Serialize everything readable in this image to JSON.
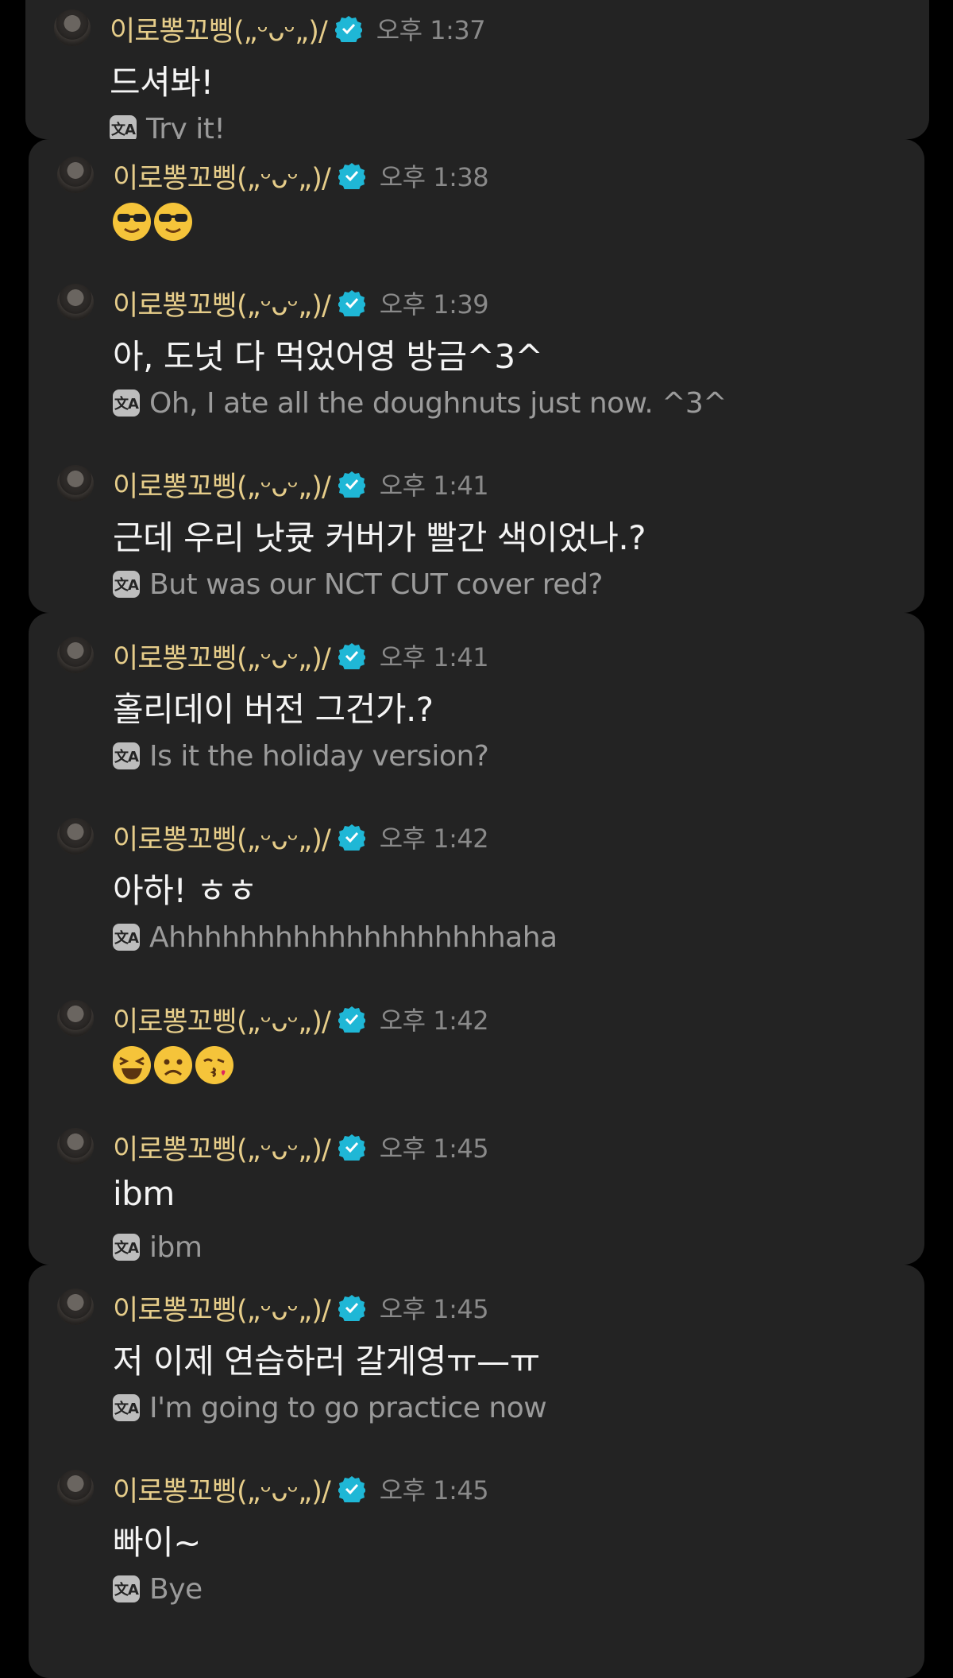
{
  "theme": {
    "name_color": "#e6cd8a",
    "verified_color": "#1fb7d6",
    "card_bg": "#232323"
  },
  "user": {
    "name": "이로뽕꼬삥(„ᵕᴗᵕ„)/"
  },
  "messages": [
    {
      "time": "오후 1:37",
      "text": "드셔봐!",
      "translation": "Try it!"
    },
    {
      "time": "오후 1:38",
      "emoji": [
        "sunglasses-emoji",
        "sunglasses-emoji"
      ]
    },
    {
      "time": "오후 1:39",
      "text": "아, 도넛 다 먹었어영 방금^3^",
      "translation": "Oh, I ate all the doughnuts just now. ^3^"
    },
    {
      "time": "오후 1:41",
      "text": "근데 우리 낫큣 커버가 빨간 색이었나.?",
      "translation": "But was our NCT CUT cover red?"
    },
    {
      "time": "오후 1:41",
      "text": "홀리데이 버전 그건가.?",
      "translation": "Is it the holiday version?"
    },
    {
      "time": "오후 1:42",
      "text": "아하! ㅎㅎ",
      "translation": "Ahhhhhhhhhhhhhhhhhhhaha"
    },
    {
      "time": "오후 1:42",
      "emoji": [
        "laughing-emoji",
        "frowning-emoji",
        "kissing-heart-emoji"
      ]
    },
    {
      "time": "오후 1:45",
      "text": "ibm",
      "translation": "ibm"
    },
    {
      "time": "오후 1:45",
      "text": "저 이제 연습하러 갈게영ㅠ—ㅠ",
      "translation": "I'm going to go practice now"
    },
    {
      "time": "오후 1:45",
      "text": "빠이~",
      "translation": "Bye"
    }
  ],
  "translate_icon_label": "文A"
}
